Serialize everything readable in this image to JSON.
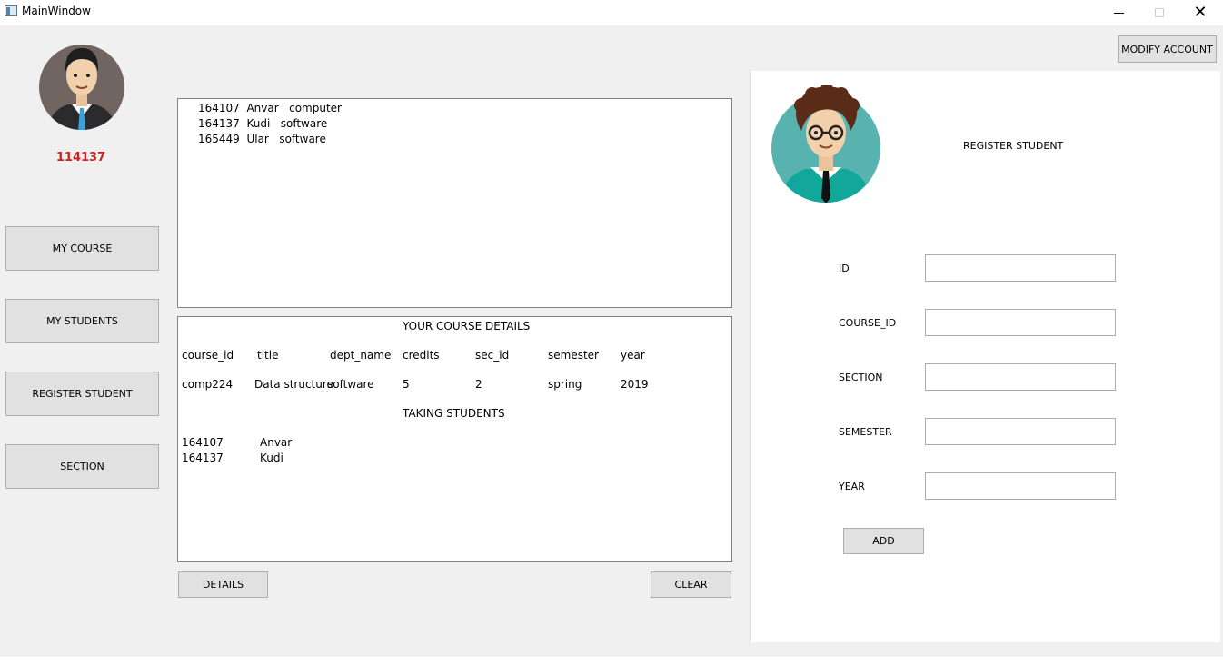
{
  "window": {
    "title": "MainWindow"
  },
  "sidebar": {
    "user_id": "114137",
    "buttons": [
      "MY COURSE",
      "MY STUDENTS",
      "REGISTER STUDENT",
      "SECTION"
    ]
  },
  "top_button": {
    "label": "MODIFY ACCOUNT"
  },
  "students_list": [
    {
      "id": "164107",
      "name": "Anvar",
      "dept": "computer"
    },
    {
      "id": "164137",
      "name": "Kudi",
      "dept": "software"
    },
    {
      "id": "165449",
      "name": "Ular",
      "dept": "software"
    }
  ],
  "course_details": {
    "heading": "YOUR COURSE DETAILS",
    "columns": [
      "course_id",
      "title",
      "dept_name",
      "credits",
      "sec_id",
      "semester",
      "year"
    ],
    "row": [
      "comp224",
      "Data structure",
      "software",
      "5",
      "2",
      "spring",
      "2019"
    ],
    "students_heading": "TAKING STUDENTS",
    "students": [
      {
        "id": "164107",
        "name": "Anvar"
      },
      {
        "id": "164137",
        "name": "Kudi"
      }
    ]
  },
  "bottom_buttons": {
    "details": "DETAILS",
    "clear": "CLEAR"
  },
  "register_panel": {
    "title": "REGISTER STUDENT",
    "fields": [
      {
        "label": "ID",
        "value": ""
      },
      {
        "label": "COURSE_ID",
        "value": ""
      },
      {
        "label": "SECTION",
        "value": ""
      },
      {
        "label": "SEMESTER",
        "value": ""
      },
      {
        "label": "YEAR",
        "value": ""
      }
    ],
    "add_label": "ADD"
  },
  "colors": {
    "user_id": "#d41f1f",
    "window_bg": "#f0f0f0",
    "button_bg": "#e1e1e1"
  },
  "icons": [
    "app-icon",
    "teacher-avatar-icon",
    "student-avatar-icon",
    "minimize-icon",
    "maximize-icon",
    "close-icon"
  ]
}
